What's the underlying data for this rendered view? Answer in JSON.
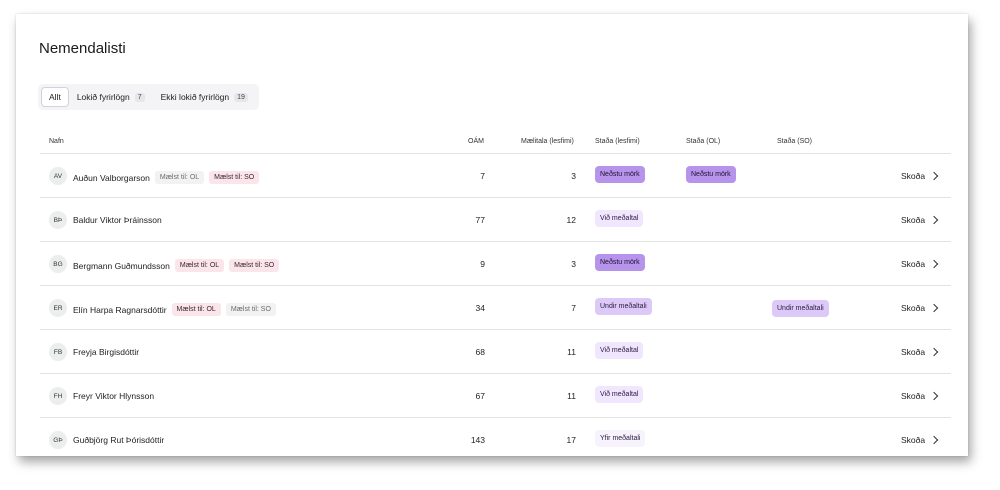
{
  "page": {
    "title": "Nemendalisti"
  },
  "tabs": [
    {
      "label": "Allt",
      "count": ""
    },
    {
      "label": "Lokið fyrirlögn",
      "count": "7"
    },
    {
      "label": "Ekki lokið fyrirlögn",
      "count": "19"
    }
  ],
  "table": {
    "headers": {
      "name": "Nafn",
      "oam": "OÁM",
      "maelitala": "Mælitala (lesfimi)",
      "stada_lesfimi": "Staða (lesfimi)",
      "stada_ol": "Staða (OL)",
      "stada_so": "Staða (SO)"
    },
    "action_label": "Skoða",
    "rows": [
      {
        "initials": "AV",
        "name": "Auðun Valborgarson",
        "badge1": "Mælst til: OL",
        "badge2": "Mælst til: SO",
        "oam": "7",
        "maelitala": "3",
        "stada_lesfimi": "Neðstu mörk",
        "stada_ol": "Neðstu mörk",
        "stada_so": ""
      },
      {
        "initials": "BÞ",
        "name": "Baldur Viktor Þráinsson",
        "badge1": "",
        "badge2": "",
        "oam": "77",
        "maelitala": "12",
        "stada_lesfimi": "Við meðaltal",
        "stada_ol": "",
        "stada_so": ""
      },
      {
        "initials": "BG",
        "name": "Bergmann Guðmundsson",
        "badge1": "Mælst til: OL",
        "badge2": "Mælst til: SO",
        "oam": "9",
        "maelitala": "3",
        "stada_lesfimi": "Neðstu mörk",
        "stada_ol": "",
        "stada_so": ""
      },
      {
        "initials": "ER",
        "name": "Elín Harpa Ragnarsdóttir",
        "badge1": "Mælst til: OL",
        "badge2": "Mælst til: SO",
        "oam": "34",
        "maelitala": "7",
        "stada_lesfimi": "Undir meðaltali",
        "stada_ol": "",
        "stada_so": "Undir meðaltali"
      },
      {
        "initials": "FB",
        "name": "Freyja Birgisdóttir",
        "badge1": "",
        "badge2": "",
        "oam": "68",
        "maelitala": "11",
        "stada_lesfimi": "Við meðaltal",
        "stada_ol": "",
        "stada_so": ""
      },
      {
        "initials": "FH",
        "name": "Freyr Viktor Hlynsson",
        "badge1": "",
        "badge2": "",
        "oam": "67",
        "maelitala": "11",
        "stada_lesfimi": "Við meðaltal",
        "stada_ol": "",
        "stada_so": ""
      },
      {
        "initials": "GÞ",
        "name": "Guðbjörg Rut Þórisdóttir",
        "badge1": "",
        "badge2": "",
        "oam": "143",
        "maelitala": "17",
        "stada_lesfimi": "Yfir meðaltali",
        "stada_ol": "",
        "stada_so": ""
      }
    ]
  }
}
